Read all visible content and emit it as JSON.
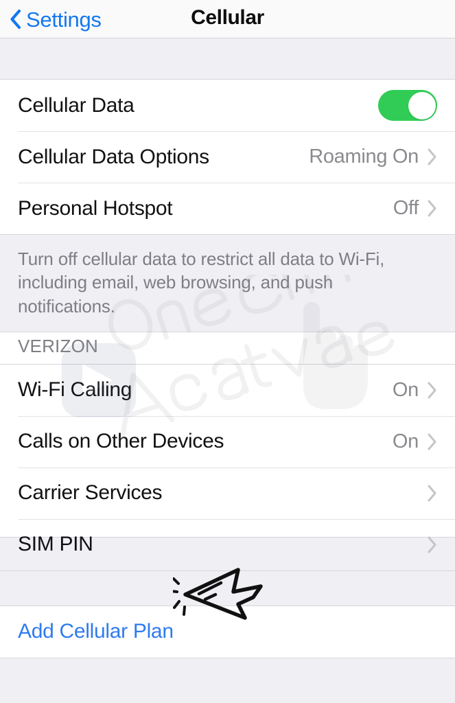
{
  "navbar": {
    "back_label": "Settings",
    "back_icon": "chevron-left-icon",
    "title": "Cellular"
  },
  "colors": {
    "accent_blue": "#1478f0",
    "link_blue": "#2e7bf0",
    "toggle_on_green": "#31cc56",
    "value_gray": "#8a8a8f",
    "chevron_gray": "#c5c5c9",
    "background_gray": "#efeff4",
    "row_background": "#ffffff",
    "separator": "#e2e2e5"
  },
  "sections": [
    {
      "name": "cellular-data-section",
      "rows": [
        {
          "label": "Cellular Data",
          "control": "toggle",
          "toggle_state": "on",
          "value": "",
          "chevron": false
        },
        {
          "label": "Cellular Data Options",
          "control": "disclosure",
          "value": "Roaming On",
          "chevron": true
        },
        {
          "label": "Personal Hotspot",
          "control": "disclosure",
          "value": "Off",
          "chevron": true
        }
      ],
      "footer": "Turn off cellular data to restrict all data to Wi-Fi, including email, web browsing, and push notifications."
    },
    {
      "name": "carrier-section",
      "header": "VERIZON",
      "rows": [
        {
          "label": "Wi-Fi Calling",
          "control": "disclosure",
          "value": "On",
          "chevron": true
        },
        {
          "label": "Calls on Other Devices",
          "control": "disclosure",
          "value": "On",
          "chevron": true
        },
        {
          "label": "Carrier Services",
          "control": "disclosure",
          "value": "",
          "chevron": true
        },
        {
          "label": "SIM PIN",
          "control": "disclosure",
          "value": "",
          "chevron": true
        }
      ]
    },
    {
      "name": "add-plan-section",
      "rows": [
        {
          "label": "Add Cellular Plan",
          "control": "link",
          "value": "",
          "chevron": false
        }
      ]
    }
  ],
  "watermark": {
    "line1": "One Click",
    "line2": "Activate",
    "logo_icon": "pointing-hand-icon"
  },
  "annotation": {
    "icon": "hand-drawn-click-cursor-icon",
    "points_at": "Add Cellular Plan"
  }
}
